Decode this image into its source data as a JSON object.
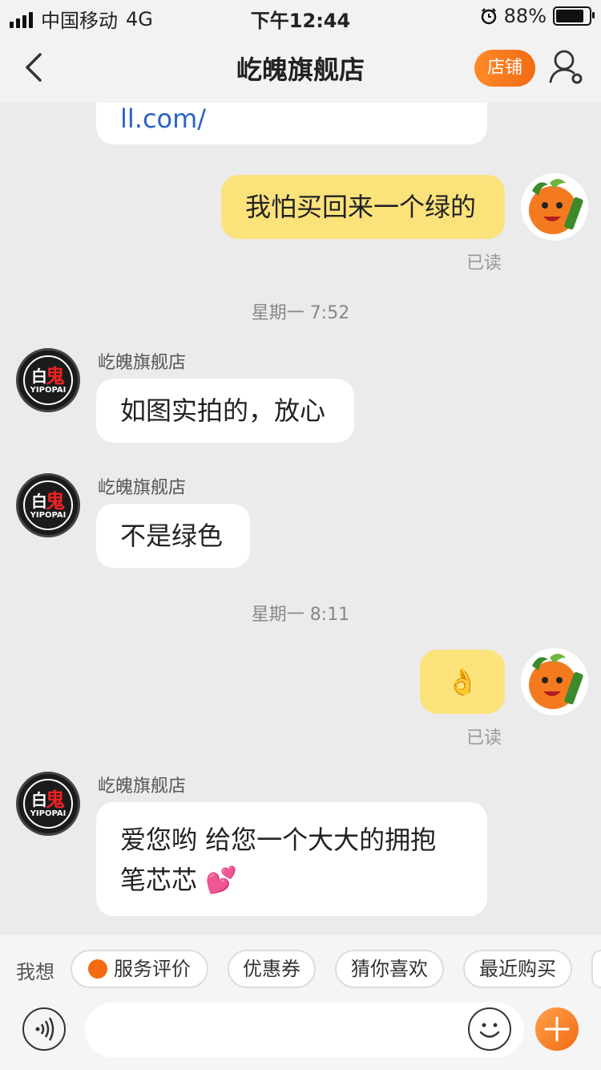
{
  "status_bar": {
    "carrier": "中国移动",
    "network": "4G",
    "time": "下午12:44",
    "battery_percent": "88%",
    "battery_level": 0.88
  },
  "nav": {
    "title": "屹魄旗舰店",
    "shop_button": "店铺",
    "back_icon": "chevron-left-icon",
    "profile_icon": "user-settings-icon"
  },
  "chat": {
    "truncated_link_text": "ll.com/",
    "messages": [
      {
        "from": "me",
        "text": "我怕买回来一个绿的",
        "status": "已读"
      },
      {
        "type": "timestamp",
        "text": "星期一 7:52"
      },
      {
        "from": "shop",
        "sender": "屹魄旗舰店",
        "text": "如图实拍的，放心"
      },
      {
        "from": "shop",
        "sender": "屹魄旗舰店",
        "text": "不是绿色"
      },
      {
        "type": "timestamp",
        "text": "星期一 8:11"
      },
      {
        "from": "me",
        "text": "👌",
        "status": "已读"
      },
      {
        "from": "shop",
        "sender": "屹魄旗舰店",
        "line1": "爱您哟 给您一个大大的拥抱",
        "line2": "笔芯芯",
        "emoji": "💕"
      }
    ],
    "shop_avatar": {
      "char1": "白",
      "char2": "鬼",
      "brand": "YIPOPAI"
    },
    "my_avatar_icon": "orange-mascot-avatar"
  },
  "quick_bar": {
    "label": "我想",
    "chips": [
      "服务评价",
      "优惠券",
      "猜你喜欢",
      "最近购买"
    ]
  },
  "input_bar": {
    "voice_icon": "voice-icon",
    "placeholder": "",
    "emoji_icon": "smiley-icon",
    "plus_icon": "plus-icon"
  },
  "colors": {
    "accent": "#f26b13",
    "my_bubble": "#fbe27b",
    "background": "#ebebeb"
  }
}
